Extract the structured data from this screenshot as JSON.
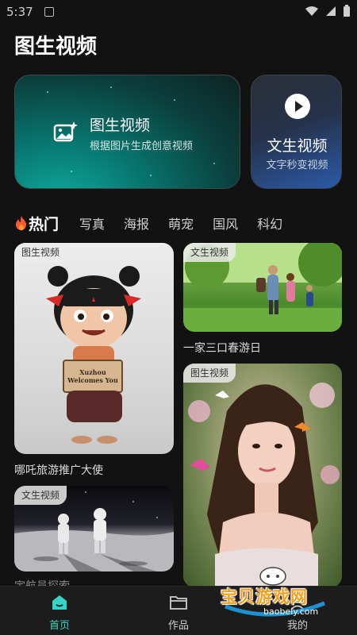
{
  "status": {
    "time": "5:37"
  },
  "header": {
    "title": "图生视频"
  },
  "cards": {
    "main": {
      "title": "图生视频",
      "subtitle": "根据图片生成创意视频",
      "icon": "image-sparkle-icon"
    },
    "side": {
      "title": "文生视频",
      "subtitle": "文字秒变视频",
      "icon": "play-icon"
    }
  },
  "tabs": [
    {
      "label": "热门",
      "icon": "fire-icon",
      "active": true
    },
    {
      "label": "写真"
    },
    {
      "label": "海报"
    },
    {
      "label": "萌宠"
    },
    {
      "label": "国风"
    },
    {
      "label": "科幻"
    }
  ],
  "tiles": [
    {
      "badge": "图生视频",
      "caption": "哪吒旅游推广大使",
      "sign_text": "Xuzhou Welcomes You"
    },
    {
      "badge": "文生视频",
      "caption": "一家三口春游日"
    },
    {
      "badge": "图生视频",
      "caption": ""
    },
    {
      "badge": "文生视频",
      "caption": "宇航员探索"
    }
  ],
  "bottom_nav": [
    {
      "label": "首页",
      "icon": "home-icon",
      "active": true
    },
    {
      "label": "作品",
      "icon": "folder-icon"
    },
    {
      "label": "我的",
      "icon": "user-icon"
    }
  ],
  "watermark": {
    "text": "宝贝游戏网",
    "url": "baobeiy.com"
  },
  "colors": {
    "accent": "#33d6c4",
    "background": "#121212",
    "watermark": "#f7a01c"
  }
}
